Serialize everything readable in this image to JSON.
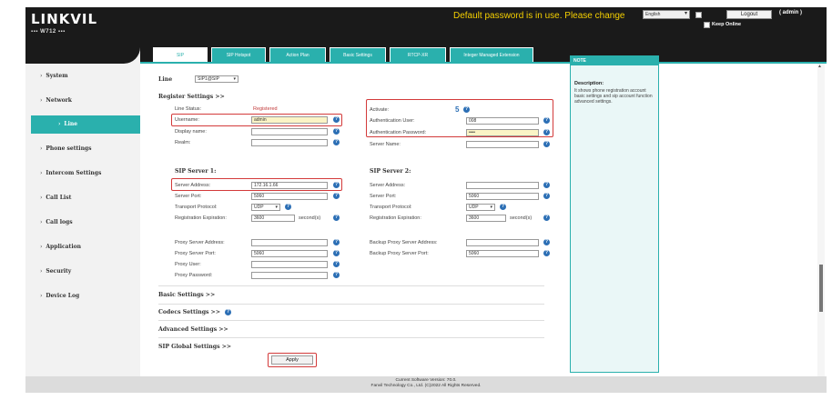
{
  "header": {
    "logo": "LINKVIL",
    "model": "W712",
    "warning": "Default password is in use. Please change",
    "language": "English",
    "logout": "Logout",
    "user": "( admin )",
    "keep_online": "Keep Online"
  },
  "sidebar": {
    "items": [
      {
        "label": "System"
      },
      {
        "label": "Network"
      },
      {
        "label": "Line"
      },
      {
        "label": "Phone settings"
      },
      {
        "label": "Intercom Settings"
      },
      {
        "label": "Call List"
      },
      {
        "label": "Call logs"
      },
      {
        "label": "Application"
      },
      {
        "label": "Security"
      },
      {
        "label": "Device Log"
      }
    ],
    "active_index": 2
  },
  "tabs": [
    {
      "label": "SIP"
    },
    {
      "label": "SIP Hotspot"
    },
    {
      "label": "Action Plan"
    },
    {
      "label": "Basic Settings"
    },
    {
      "label": "RTCP-XR"
    },
    {
      "label": "Integer Managed Extension"
    }
  ],
  "line": {
    "label": "Line",
    "value": "SIP1@SIP"
  },
  "register": {
    "title": "Register Settings >>",
    "line_status_label": "Line Status:",
    "line_status_value": "Registered",
    "username_label": "Username:",
    "username_value": "admin",
    "display_name_label": "Display name:",
    "realm_label": "Realm:",
    "activate_label": "Activate:",
    "activate_value": "5",
    "auth_user_label": "Authentication User:",
    "auth_user_value": "008",
    "auth_password_label": "Authentication Password:",
    "auth_password_value": "••••",
    "server_name_label": "Server Name:"
  },
  "server1": {
    "title": "SIP Server 1:",
    "address_label": "Server Address:",
    "address_value": "172.16.1.66",
    "port_label": "Server Port:",
    "port_value": "5060",
    "transport_label": "Transport Protocol:",
    "transport_value": "UDP",
    "expiration_label": "Registration Expiration:",
    "expiration_value": "3600",
    "unit": "second(s)"
  },
  "server2": {
    "title": "SIP Server 2:",
    "address_label": "Server Address:",
    "port_label": "Server Port:",
    "port_value": "5060",
    "transport_label": "Transport Protocol:",
    "transport_value": "UDP",
    "expiration_label": "Registration Expiration:",
    "expiration_value": "3600",
    "unit": "second(s)"
  },
  "proxy": {
    "address_label": "Proxy Server Address:",
    "port_label": "Proxy Server Port:",
    "port_value": "5060",
    "user_label": "Proxy User:",
    "password_label": "Proxy Password:",
    "backup_address_label": "Backup Proxy Server Address:",
    "backup_port_label": "Backup Proxy Server Port:",
    "backup_port_value": "5060"
  },
  "sections": {
    "basic": "Basic Settings >>",
    "codecs": "Codecs Settings >>",
    "advanced": "Advanced Settings >>",
    "global": "SIP Global Settings >>"
  },
  "apply": "Apply",
  "description": {
    "header": "NOTE",
    "title": "Description:",
    "text": "It shows phone registration account basic settings and sip account function advanced settings."
  },
  "footer": {
    "version": "Current Software Version: 70.0.",
    "copyright": "Fanvil Technology Co., Ltd. (C)2022 All Rights Reserved."
  },
  "colors": {
    "accent": "#2ab0ad",
    "warning": "#f5d000",
    "highlight": "#d33a3a"
  }
}
